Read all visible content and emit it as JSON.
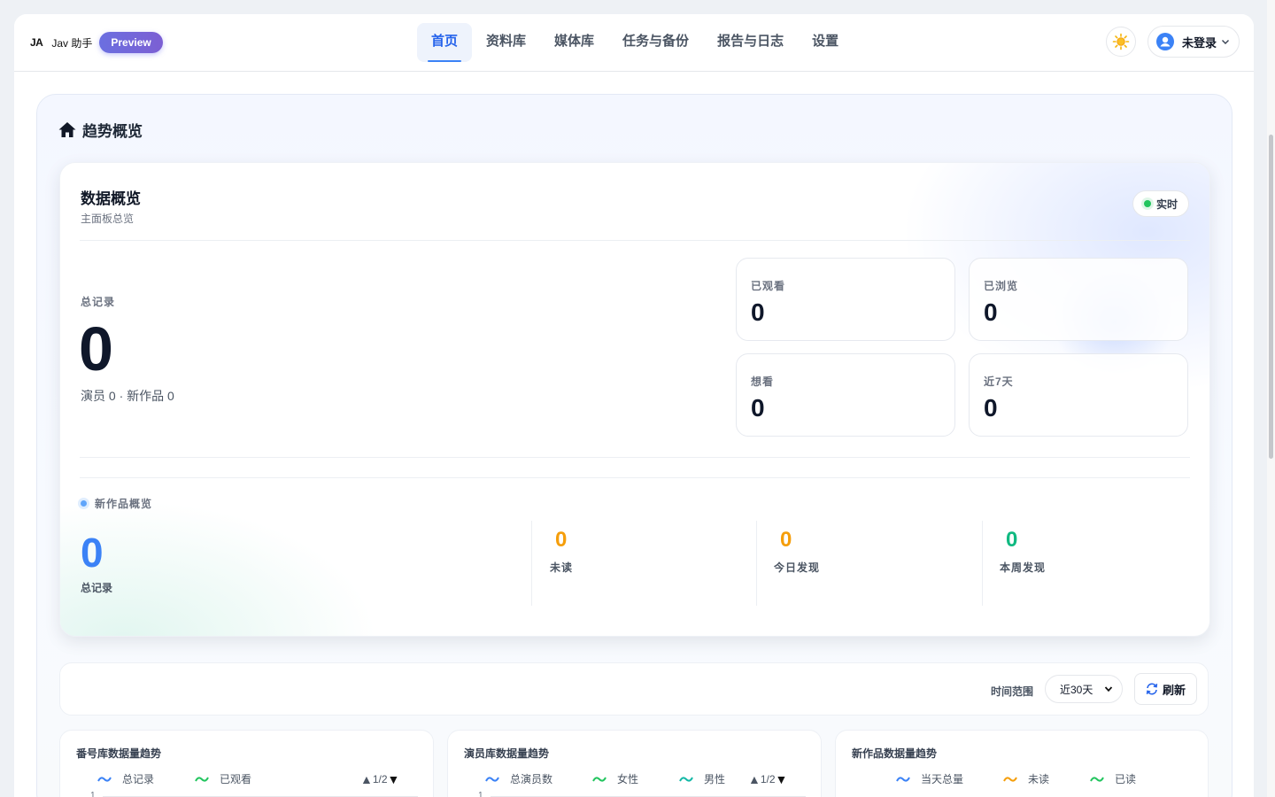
{
  "header": {
    "logo": "JA",
    "app_name": "Jav 助手",
    "badge": "Preview",
    "nav": [
      {
        "label": "首页",
        "active": true
      },
      {
        "label": "资料库"
      },
      {
        "label": "媒体库"
      },
      {
        "label": "任务与备份"
      },
      {
        "label": "报告与日志"
      },
      {
        "label": "设置"
      }
    ],
    "user_label": "未登录"
  },
  "trend": {
    "title": "趋势概览"
  },
  "overview": {
    "title": "数据概览",
    "subtitle": "主面板总览",
    "live_label": "实时",
    "total_label": "总记录",
    "total_value": "0",
    "total_sub": "演员 0 · 新作品 0",
    "stats": [
      {
        "label": "已观看",
        "value": "0"
      },
      {
        "label": "已浏览",
        "value": "0"
      },
      {
        "label": "想看",
        "value": "0"
      },
      {
        "label": "近7天",
        "value": "0"
      }
    ],
    "new_section": {
      "title": "新作品概览",
      "total_value": "0",
      "total_label": "总记录",
      "items": [
        {
          "label": "未读",
          "value": "0",
          "color": "#f59e0b"
        },
        {
          "label": "今日发现",
          "value": "0",
          "color": "#f59e0b"
        },
        {
          "label": "本周发现",
          "value": "0",
          "color": "#10b981"
        }
      ]
    }
  },
  "filter": {
    "range_label": "时间范围",
    "range_value": "近30天",
    "refresh_label": "刷新"
  },
  "charts": [
    {
      "title": "番号库数据量趋势",
      "legend": [
        {
          "label": "总记录",
          "color": "#3b82f6"
        },
        {
          "label": "已观看",
          "color": "#22c55e"
        }
      ],
      "pager": "1/2",
      "y_tick": "1"
    },
    {
      "title": "演员库数据量趋势",
      "legend": [
        {
          "label": "总演员数",
          "color": "#3b82f6"
        },
        {
          "label": "女性",
          "color": "#22c55e"
        },
        {
          "label": "男性",
          "color": "#14b8a6"
        }
      ],
      "pager": "1/2",
      "y_tick": "1"
    },
    {
      "title": "新作品数据量趋势",
      "legend": [
        {
          "label": "当天总量",
          "color": "#3b82f6"
        },
        {
          "label": "未读",
          "color": "#f59e0b"
        },
        {
          "label": "已读",
          "color": "#22c55e"
        }
      ]
    }
  ]
}
